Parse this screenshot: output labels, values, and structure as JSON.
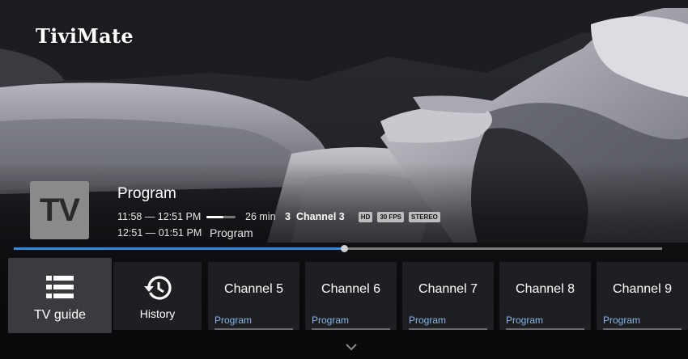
{
  "app": {
    "logo_text": "TiviMate"
  },
  "now_playing": {
    "channel_logo_text": "TV",
    "program_title": "Program",
    "time_range": "11:58 — 12:51 PM",
    "elapsed_fraction": 0.58,
    "duration": "26 min",
    "channel_number": "3",
    "channel_name": "Channel 3",
    "badges": [
      "HD",
      "30 FPS",
      "STEREO"
    ],
    "next_time_range": "12:51 — 01:51 PM",
    "next_program": "Program",
    "playback_progress_fraction": 0.51
  },
  "menu": {
    "tv_guide_label": "TV guide",
    "history_label": "History"
  },
  "channels": [
    {
      "name": "Channel 5",
      "program": "Program"
    },
    {
      "name": "Channel 6",
      "program": "Program"
    },
    {
      "name": "Channel 7",
      "program": "Program"
    },
    {
      "name": "Channel 8",
      "program": "Program"
    },
    {
      "name": "Channel 9",
      "program": "Program"
    }
  ],
  "colors": {
    "accent": "#2f8be3",
    "program_text": "#8ab4e8"
  }
}
